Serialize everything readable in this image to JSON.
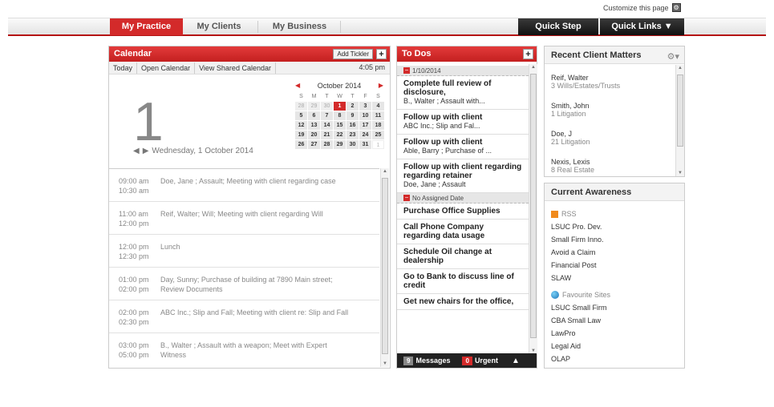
{
  "header": {
    "customize_label": "Customize this page",
    "nav_tabs": [
      {
        "label": "My Practice"
      },
      {
        "label": "My Clients"
      },
      {
        "label": "My Business"
      }
    ],
    "quick_step": "Quick Step",
    "quick_links": "Quick Links ▼"
  },
  "calendar": {
    "title": "Calendar",
    "add_tickler": "Add Tickler",
    "toolbar": [
      "Today",
      "Open Calendar",
      "View Shared Calendar"
    ],
    "current_time": "4:05 pm",
    "big_day": "1",
    "date_text": "Wednesday, 1 October 2014",
    "mini_month": "October 2014",
    "dow": [
      "S",
      "M",
      "T",
      "W",
      "T",
      "F",
      "S"
    ],
    "appointments": [
      {
        "start": "09:00 am",
        "end": "10:30 am",
        "line1": "Doe, Jane ; Assault; Meeting with client regarding case",
        "line2": ""
      },
      {
        "start": "11:00 am",
        "end": "12:00 pm",
        "line1": "Reif, Walter; Will; Meeting with client regarding Will",
        "line2": ""
      },
      {
        "start": "12:00 pm",
        "end": "12:30 pm",
        "line1": "Lunch",
        "line2": ""
      },
      {
        "start": "01:00 pm",
        "end": "02:00 pm",
        "line1": "Day, Sunny; Purchase of building at 7890 Main street;",
        "line2": "Review Documents"
      },
      {
        "start": "02:00 pm",
        "end": "02:30 pm",
        "line1": "ABC Inc.; Slip and Fall; Meeting with client re: Slip and Fall",
        "line2": ""
      },
      {
        "start": "03:00 pm",
        "end": "05:00 pm",
        "line1": "B., Walter ; Assault with a weapon; Meet with Expert",
        "line2": "Witness"
      }
    ]
  },
  "todos": {
    "title": "To Dos",
    "group1": "1/10/2014",
    "group2": "No Assigned Date",
    "items_dated": [
      {
        "title": "Complete full review of disclosure,",
        "sub": "B., Walter ; Assault with..."
      },
      {
        "title": "Follow up with client",
        "sub": "ABC Inc.; Slip and Fal..."
      },
      {
        "title": "Follow up with client",
        "sub": "Able, Barry ; Purchase of ..."
      },
      {
        "title": "Follow up with client regarding regarding retainer",
        "sub": "Doe, Jane ; Assault"
      }
    ],
    "items_undated": [
      {
        "title": "Purchase Office Supplies"
      },
      {
        "title": "Call Phone Company regarding data usage"
      },
      {
        "title": "Schedule Oil change at dealership"
      },
      {
        "title": "Go to Bank to discuss line of credit"
      },
      {
        "title": "Get new chairs for the office,"
      }
    ],
    "messages_count": "9",
    "messages_label": "Messages",
    "urgent_count": "0",
    "urgent_label": "Urgent"
  },
  "matters": {
    "title": "Recent Client Matters",
    "items": [
      {
        "name": "Reif, Walter",
        "detail": "3   Wills/Estates/Trusts"
      },
      {
        "name": "Smith, John",
        "detail": "1   Litigation"
      },
      {
        "name": "Doe, J",
        "detail": "21   Litigation"
      },
      {
        "name": "Nexis, Lexis",
        "detail": "8   Real Estate"
      }
    ]
  },
  "awareness": {
    "title": "Current Awareness",
    "rss_label": "RSS",
    "rss_items": [
      "LSUC Pro. Dev.",
      "Small Firm Inno.",
      "Avoid a Claim",
      "Financial Post",
      "SLAW"
    ],
    "fav_label": "Favourite Sites",
    "fav_items": [
      "LSUC Small Firm",
      "CBA Small Law",
      "LawPro",
      "Legal Aid",
      "OLAP"
    ]
  },
  "colors": {
    "accent": "#d32a2a",
    "dark": "#1a1a1a"
  }
}
